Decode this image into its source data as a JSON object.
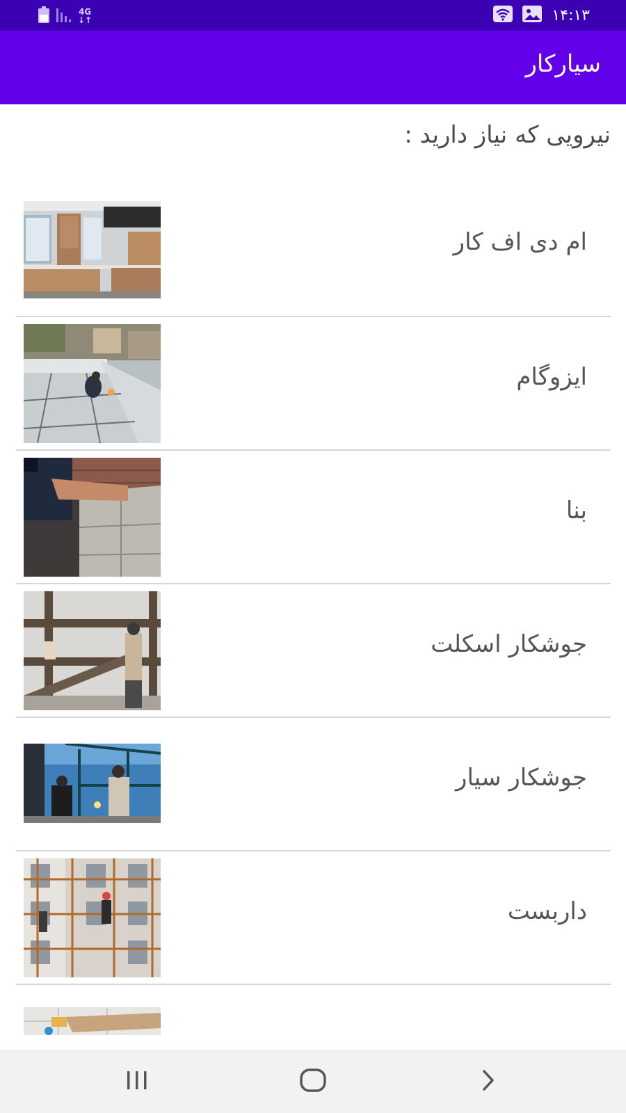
{
  "status_bar": {
    "time": "۱۴:۱۳",
    "network": "4G",
    "icons": [
      "battery-icon",
      "signal-icon",
      "network-4g-icon",
      "wifi-icon",
      "image-notification-icon"
    ]
  },
  "app_bar": {
    "title": "سیارکار"
  },
  "prompt": "نیرویی که نیاز دارید :",
  "list": {
    "items": [
      {
        "label": "ام دی اف کار",
        "image": "kitchen-cabinets-photo"
      },
      {
        "label": "ایزوگام",
        "image": "roof-insulation-worker-photo"
      },
      {
        "label": "بنا",
        "image": "bricklayer-photo"
      },
      {
        "label": "جوشکار اسکلت",
        "image": "steel-frame-welder-photo"
      },
      {
        "label": "جوشکار سیار",
        "image": "mobile-welder-photo"
      },
      {
        "label": "داربست",
        "image": "scaffolding-workers-photo"
      },
      {
        "label": "",
        "image": "tiling-photo"
      }
    ]
  },
  "nav_bar": {
    "icons": [
      "recent-apps-icon",
      "home-icon",
      "back-icon"
    ]
  },
  "colors": {
    "status_bar": "#3b01b3",
    "app_bar": "#6200ea",
    "text_primary": "#555555",
    "divider": "#d6d6d6",
    "nav_bar": "#f2f2f2"
  }
}
